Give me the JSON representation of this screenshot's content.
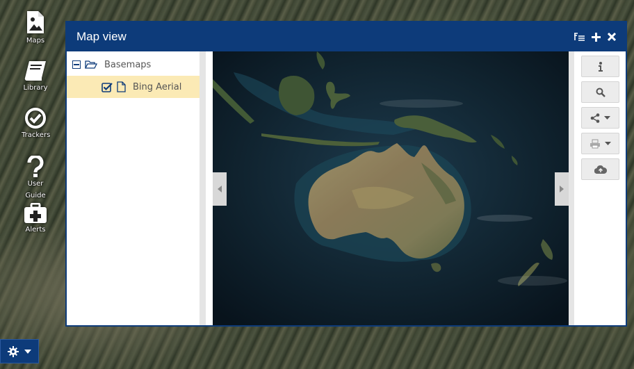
{
  "rail": {
    "items": [
      {
        "label": "Maps",
        "icon": "image-file-icon"
      },
      {
        "label": "Library",
        "icon": "book-icon"
      },
      {
        "label": "Trackers",
        "icon": "check-circle-icon"
      },
      {
        "label": "User Guide",
        "icon": "question-icon"
      },
      {
        "label": "Alerts",
        "icon": "medkit-icon"
      }
    ]
  },
  "panel": {
    "title": "Map view"
  },
  "layers": {
    "group": {
      "label": "Basemaps",
      "expanded": true
    },
    "items": [
      {
        "label": "Bing Aerial",
        "checked": true
      }
    ]
  },
  "toolbar": {
    "buttons": [
      "info-icon",
      "search-icon",
      "share-icon",
      "print-icon",
      "cloud-upload-icon"
    ]
  },
  "colors": {
    "header": "#0d3b7a",
    "selected_row": "#fbeab5",
    "ocean": "#0c1a26"
  }
}
